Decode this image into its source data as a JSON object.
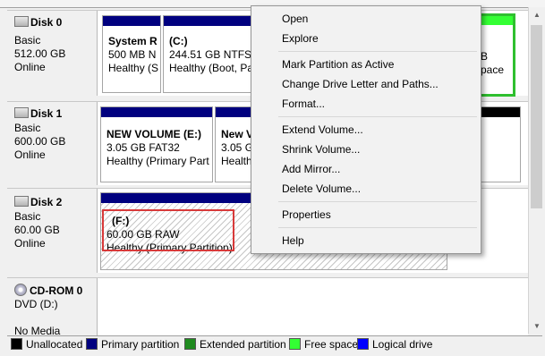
{
  "disks": [
    {
      "name": "Disk 0",
      "type": "Basic",
      "size": "512.00 GB",
      "status": "Online"
    },
    {
      "name": "Disk 1",
      "type": "Basic",
      "size": "600.00 GB",
      "status": "Online"
    },
    {
      "name": "Disk 2",
      "type": "Basic",
      "size": "60.00 GB",
      "status": "Online"
    },
    {
      "name": "CD-ROM 0",
      "type": "DVD (D:)",
      "status": "No Media"
    }
  ],
  "disk0": {
    "sysres": {
      "title": "System R",
      "size": "500 MB N",
      "health": "Healthy (S"
    },
    "c": {
      "title": "(C:)",
      "size": "244.51 GB NTFS",
      "health": "Healthy (Boot, Pa"
    },
    "right_partial": {
      "size": "B",
      "health": "pace"
    }
  },
  "disk1": {
    "e": {
      "title": "NEW VOLUME  (E:)",
      "size": "3.05 GB FAT32",
      "health": "Healthy (Primary Part"
    },
    "next": {
      "title": "New V",
      "size": "3.05 G",
      "health": "Health"
    }
  },
  "disk2": {
    "f": {
      "title": "(F:)",
      "size": "60.00 GB RAW",
      "health": "Healthy (Primary Partition)"
    }
  },
  "context_menu": {
    "open": "Open",
    "explore": "Explore",
    "mark_active": "Mark Partition as Active",
    "change_letter": "Change Drive Letter and Paths...",
    "format": "Format...",
    "extend": "Extend Volume...",
    "shrink": "Shrink Volume...",
    "add_mirror": "Add Mirror...",
    "delete": "Delete Volume...",
    "properties": "Properties",
    "help": "Help"
  },
  "legend": [
    {
      "label": "Unallocated",
      "color": "#000000"
    },
    {
      "label": "Primary partition",
      "color": "#00007f"
    },
    {
      "label": "Extended partition",
      "color": "#1f8a1f"
    },
    {
      "label": "Free space",
      "color": "#33ff33"
    },
    {
      "label": "Logical drive",
      "color": "#0000ff"
    }
  ]
}
